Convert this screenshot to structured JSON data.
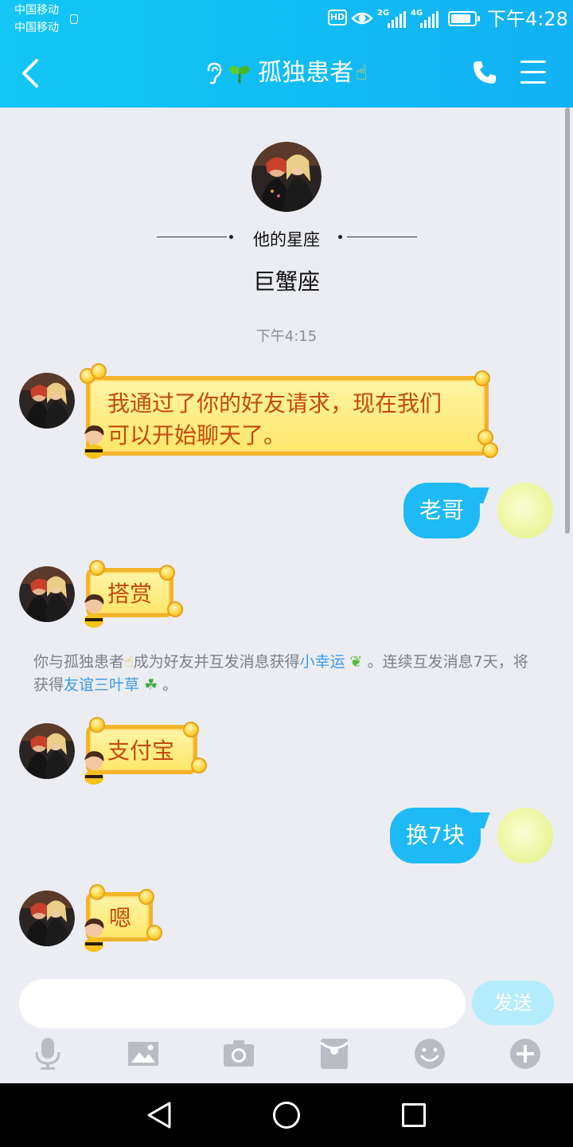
{
  "status_bar": {
    "carrier_1": "中国移动",
    "carrier_2": "中国移动",
    "hd": "HD",
    "net_1": "2G",
    "net_2": "4G",
    "battery_level": 0.85,
    "time": "下午4:28"
  },
  "header": {
    "title": "孤独患者",
    "title_emoji": "☝",
    "back_icon": "chevron-left-icon",
    "phone_icon": "phone-icon",
    "menu_icon": "menu-icon"
  },
  "profile": {
    "zodiac_label": "他的星座",
    "zodiac_value": "巨蟹座"
  },
  "chat": {
    "timestamp": "下午4:15",
    "messages": [
      {
        "from": "friend",
        "text_line1": "我通过了你的好友请求，现在我们",
        "text_line2": "可以开始聊天了。"
      },
      {
        "from": "me",
        "text": "老哥"
      },
      {
        "from": "friend",
        "text": "搭赏"
      },
      {
        "from": "friend",
        "text": "支付宝"
      },
      {
        "from": "me",
        "text": "换7块"
      },
      {
        "from": "friend",
        "text": "嗯"
      }
    ],
    "system": {
      "part1": "你与孤独患者",
      "hand": "☝",
      "part2": "成为好友并互发消息获得",
      "link1": "小幸运",
      "part3": " 。连续互发消息7天，将获得",
      "link2": "友谊三叶草",
      "part4": " 。"
    }
  },
  "input": {
    "placeholder": "",
    "send_label": "发送"
  },
  "colors": {
    "header": "#13c6f5",
    "my_bubble": "#1ebaf6",
    "link": "#3e9ae8",
    "bee_text": "#c34a0c"
  }
}
